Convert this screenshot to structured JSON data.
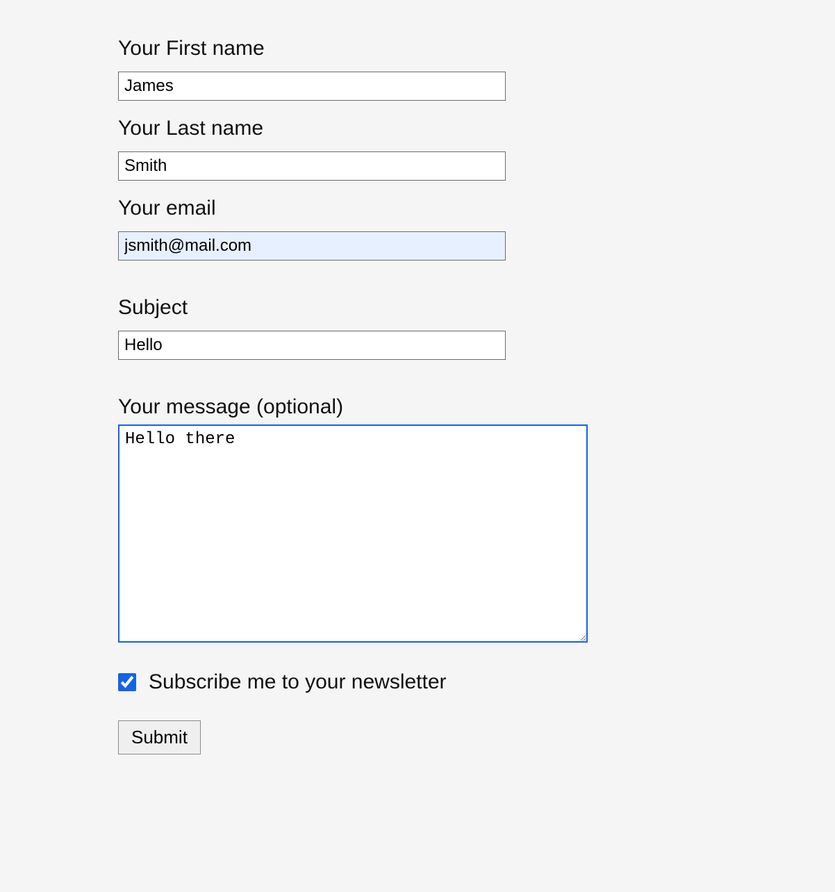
{
  "form": {
    "first_name": {
      "label": "Your First name",
      "value": "James"
    },
    "last_name": {
      "label": "Your Last name",
      "value": "Smith"
    },
    "email": {
      "label": "Your email",
      "value": "jsmith@mail.com"
    },
    "subject": {
      "label": "Subject",
      "value": "Hello"
    },
    "message": {
      "label": "Your message (optional)",
      "value": "Hello there"
    },
    "subscribe": {
      "label": "Subscribe me to your newsletter",
      "checked": true
    },
    "submit_label": "Submit"
  }
}
